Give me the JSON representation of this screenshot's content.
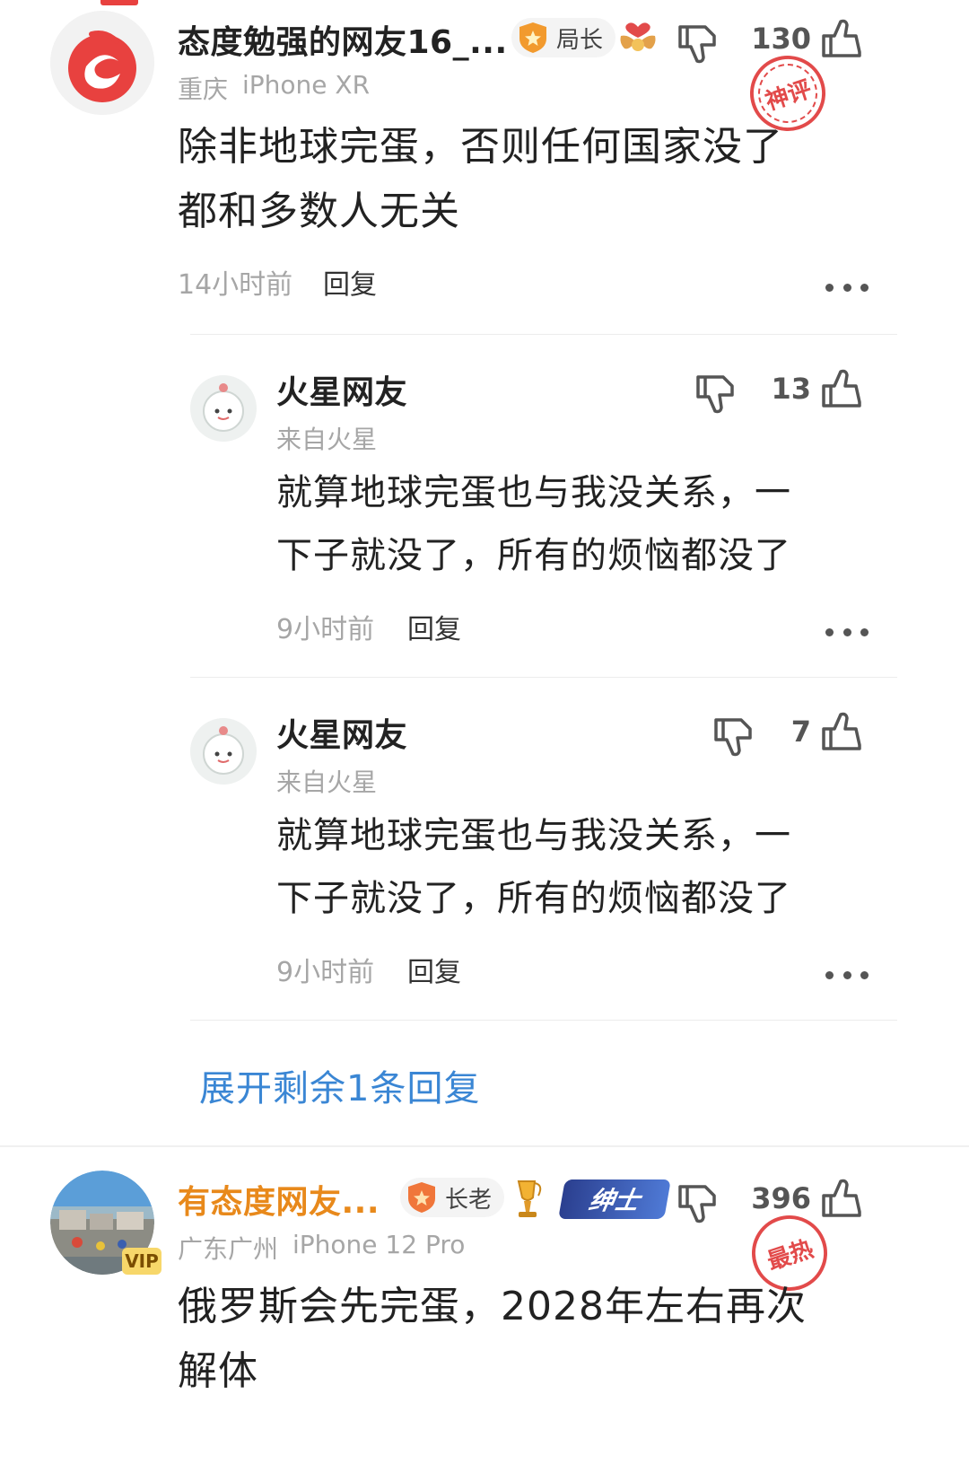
{
  "comments": [
    {
      "username": "态度勉强的网友16_...",
      "badge": "局长",
      "meta_location": "重庆",
      "meta_device": "iPhone XR",
      "text_line1": "除非地球完蛋，否则任何国家没了",
      "text_line2": "都和多数人无关",
      "time": "14小时前",
      "reply_label": "回复",
      "like_count": "130",
      "stamp": "神评"
    },
    {
      "username": "有态度网友...",
      "badge": "长老",
      "vip": "VIP",
      "gentleman_badge": "绅士",
      "meta_location": "广东广州",
      "meta_device": "iPhone 12 Pro",
      "text_line1": "俄罗斯会先完蛋，2028年左右再次",
      "text_line2": "解体",
      "like_count": "396",
      "stamp": "最热"
    }
  ],
  "replies": [
    {
      "username": "火星网友",
      "meta": "来自火星",
      "text_line1": "就算地球完蛋也与我没关系，一",
      "text_line2": "下子就没了，所有的烦恼都没了",
      "time": "9小时前",
      "reply_label": "回复",
      "like_count": "13"
    },
    {
      "username": "火星网友",
      "meta": "来自火星",
      "text_line1": "就算地球完蛋也与我没关系，一",
      "text_line2": "下子就没了，所有的烦恼都没了",
      "time": "9小时前",
      "reply_label": "回复",
      "like_count": "7"
    }
  ],
  "expand_label": "展开剩余1条回复",
  "colors": {
    "accent_blue": "#3a86d4",
    "name_orange": "#e8891b",
    "stamp_red": "#e24a4a"
  }
}
